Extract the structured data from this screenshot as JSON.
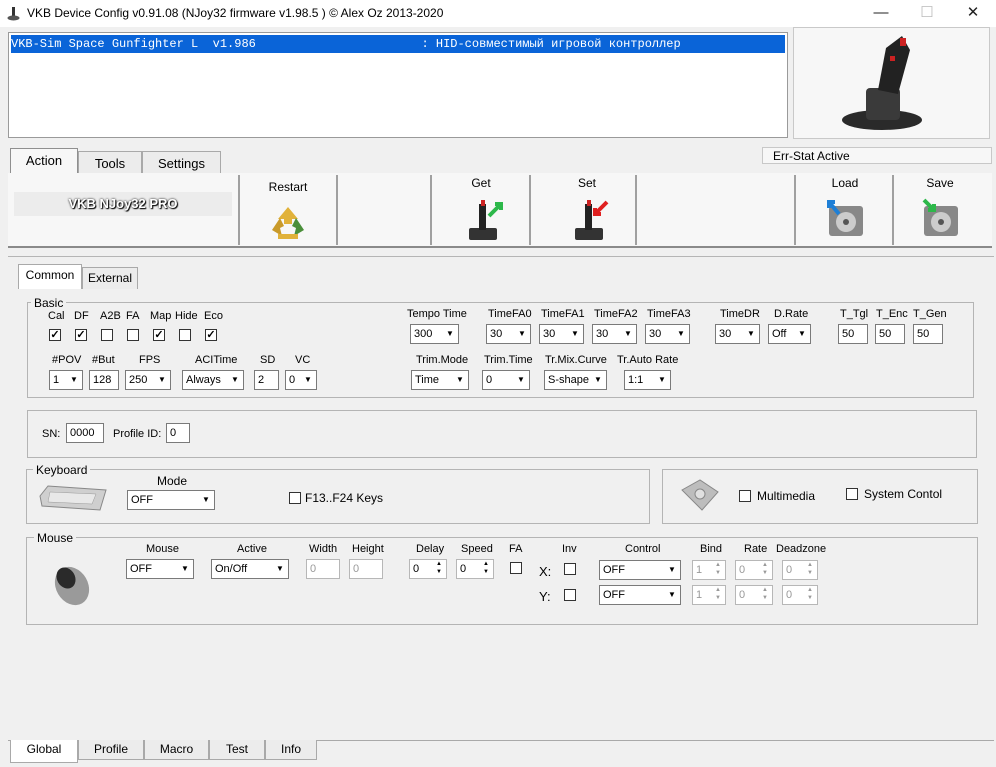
{
  "window": {
    "title": "VKB Device Config v0.91.08 (NJoy32 firmware v1.98.5  ) © Alex Oz 2013-2020",
    "minimize": "—",
    "maximize": "☐",
    "close": "✕"
  },
  "device_list": {
    "row": "VKB-Sim Space Gunfighter L  v1.986                       : HID-совместимый игровой контроллер"
  },
  "main_tabs": [
    "Action",
    "Tools",
    "Settings"
  ],
  "err_stat": "Err-Stat Active",
  "toolbar": {
    "device_name": "VKB NJoy32 PRO",
    "restart": "Restart",
    "get": "Get",
    "set": "Set",
    "load": "Load",
    "save": "Save"
  },
  "sub_tabs": [
    "Common",
    "External"
  ],
  "basic": {
    "title": "Basic",
    "flags": [
      {
        "label": "Cal",
        "checked": true
      },
      {
        "label": "DF",
        "checked": true
      },
      {
        "label": "A2B",
        "checked": false
      },
      {
        "label": "FA",
        "checked": false
      },
      {
        "label": "Map",
        "checked": true
      },
      {
        "label": "Hide",
        "checked": false
      },
      {
        "label": "Eco",
        "checked": true
      }
    ],
    "row2": [
      {
        "label": "#POV",
        "value": "1"
      },
      {
        "label": "#But",
        "value": "128"
      },
      {
        "label": "FPS",
        "value": "250"
      },
      {
        "label": "ACITime",
        "value": "Always"
      },
      {
        "label": "SD",
        "value": "2"
      },
      {
        "label": "VC",
        "value": "0"
      }
    ],
    "tempo": [
      {
        "label": "Tempo Time",
        "value": "300"
      },
      {
        "label": "TimeFA0",
        "value": "30"
      },
      {
        "label": "TimeFA1",
        "value": "30"
      },
      {
        "label": "TimeFA2",
        "value": "30"
      },
      {
        "label": "TimeFA3",
        "value": "30"
      },
      {
        "label": "TimeDR",
        "value": "30"
      },
      {
        "label": "D.Rate",
        "value": "Off"
      },
      {
        "label": "T_Tgl",
        "value": "50"
      },
      {
        "label": "T_Enc",
        "value": "50"
      },
      {
        "label": "T_Gen",
        "value": "50"
      }
    ],
    "trim": [
      {
        "label": "Trim.Mode",
        "value": "Time"
      },
      {
        "label": "Trim.Time",
        "value": "0"
      },
      {
        "label": "Tr.Mix.Curve",
        "value": "S-shape"
      },
      {
        "label": "Tr.Auto Rate",
        "value": "1:1"
      }
    ]
  },
  "sn": {
    "label": "SN:",
    "value": "0000",
    "profile_label": "Profile ID:",
    "profile_value": "0"
  },
  "keyboard": {
    "title": "Keyboard",
    "mode_label": "Mode",
    "mode_value": "OFF",
    "f13_label": "F13..F24 Keys"
  },
  "media": {
    "multimedia": "Multimedia",
    "system": "System Contol"
  },
  "mouse": {
    "title": "Mouse",
    "headers": {
      "mouse": "Mouse",
      "active": "Active",
      "width": "Width",
      "height": "Height",
      "delay": "Delay",
      "speed": "Speed",
      "fa": "FA",
      "inv": "Inv",
      "control": "Control",
      "bind": "Bind",
      "rate": "Rate",
      "deadzone": "Deadzone"
    },
    "mouse_value": "OFF",
    "active_value": "On/Off",
    "width_value": "0",
    "height_value": "0",
    "delay_value": "0",
    "speed_value": "0",
    "axes": [
      {
        "label": "X:",
        "control": "OFF",
        "bind": "1",
        "rate": "0",
        "deadzone": "0"
      },
      {
        "label": "Y:",
        "control": "OFF",
        "bind": "1",
        "rate": "0",
        "deadzone": "0"
      }
    ]
  },
  "bottom_tabs": [
    "Global",
    "Profile",
    "Macro",
    "Test",
    "Info"
  ]
}
